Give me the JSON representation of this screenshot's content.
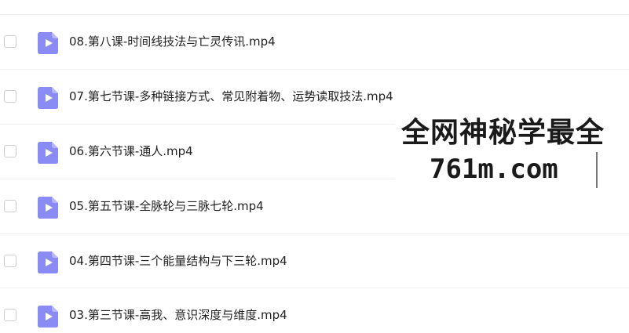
{
  "files": [
    {
      "name": "08.第八课-时间线技法与亡灵传讯.mp4",
      "icon": "video-file-icon"
    },
    {
      "name": "07.第七节课-多种链接方式、常见附着物、运势读取技法.mp4",
      "icon": "video-file-icon"
    },
    {
      "name": "06.第六节课-通人.mp4",
      "icon": "video-file-icon"
    },
    {
      "name": "05.第五节课-全脉轮与三脉七轮.mp4",
      "icon": "video-file-icon"
    },
    {
      "name": "04.第四节课-三个能量结构与下三轮.mp4",
      "icon": "video-file-icon"
    },
    {
      "name": "03.第三节课-高我、意识深度与维度.mp4",
      "icon": "video-file-icon"
    }
  ],
  "watermark": {
    "line1": "全网神秘学最全",
    "line2": "761m.com"
  },
  "colors": {
    "file_icon": "#8b8bf5",
    "divider": "#eef0f2",
    "text": "#222222"
  }
}
